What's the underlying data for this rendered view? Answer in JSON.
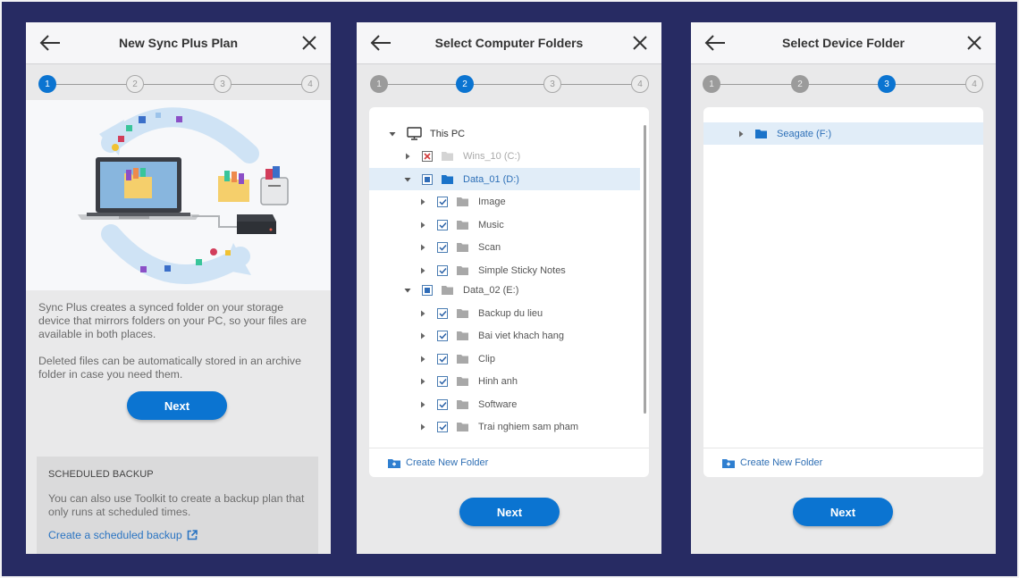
{
  "panels": [
    {
      "title": "New Sync Plus Plan",
      "active_step": 1,
      "steps": [
        "1",
        "2",
        "3",
        "4"
      ],
      "description": [
        "Sync Plus creates a synced folder on your storage device that mirrors folders on your PC, so your files are available in both places.",
        "Deleted files can be automatically stored in an archive folder in case you need them."
      ],
      "next_label": "Next",
      "scheduled": {
        "heading": "SCHEDULED BACKUP",
        "text": "You can also use Toolkit to create a backup plan that only runs at scheduled times.",
        "link": "Create a scheduled backup"
      }
    },
    {
      "title": "Select Computer Folders",
      "active_step": 2,
      "steps": [
        "1",
        "2",
        "3",
        "4"
      ],
      "tree": [
        {
          "label": "This PC",
          "level": 0,
          "expanded": true,
          "icon": "monitor-icon",
          "check": "none"
        },
        {
          "label": "Wins_10 (C:)",
          "level": 1,
          "expanded": false,
          "icon": "folder-icon",
          "check": "excluded",
          "disabled": true
        },
        {
          "label": "Data_01 (D:)",
          "level": 1,
          "expanded": true,
          "icon": "folder-icon",
          "check": "partial",
          "selected": true
        },
        {
          "label": "Image",
          "level": 2,
          "expanded": false,
          "icon": "folder-icon",
          "check": "checked"
        },
        {
          "label": "Music",
          "level": 2,
          "expanded": false,
          "icon": "folder-icon",
          "check": "checked"
        },
        {
          "label": "Scan",
          "level": 2,
          "expanded": false,
          "icon": "folder-icon",
          "check": "checked"
        },
        {
          "label": "Simple Sticky Notes",
          "level": 2,
          "expanded": false,
          "icon": "folder-icon",
          "check": "checked"
        },
        {
          "label": "Data_02 (E:)",
          "level": 1,
          "expanded": true,
          "icon": "folder-icon",
          "check": "partial"
        },
        {
          "label": "Backup du lieu",
          "level": 2,
          "expanded": false,
          "icon": "folder-icon",
          "check": "checked"
        },
        {
          "label": "Bai viet khach hang",
          "level": 2,
          "expanded": false,
          "icon": "folder-icon",
          "check": "checked"
        },
        {
          "label": "Clip",
          "level": 2,
          "expanded": false,
          "icon": "folder-icon",
          "check": "checked"
        },
        {
          "label": "Hinh anh",
          "level": 2,
          "expanded": false,
          "icon": "folder-icon",
          "check": "checked"
        },
        {
          "label": "Software",
          "level": 2,
          "expanded": false,
          "icon": "folder-icon",
          "check": "checked"
        },
        {
          "label": "Trai nghiem sam pham",
          "level": 2,
          "expanded": false,
          "icon": "folder-icon",
          "check": "checked"
        }
      ],
      "create_folder_label": "Create New Folder",
      "next_label": "Next"
    },
    {
      "title": "Select Device Folder",
      "active_step": 3,
      "steps": [
        "1",
        "2",
        "3",
        "4"
      ],
      "tree": [
        {
          "label": "Seagate (F:)",
          "level": 0,
          "expanded": false,
          "icon": "folder-icon",
          "selected": true
        }
      ],
      "create_folder_label": "Create New Folder",
      "next_label": "Next"
    }
  ],
  "colors": {
    "accent": "#0b74d1",
    "background": "#272b63",
    "panel": "#e9e9ea",
    "selected_row": "#e1edf8",
    "link": "#2a74c2"
  }
}
